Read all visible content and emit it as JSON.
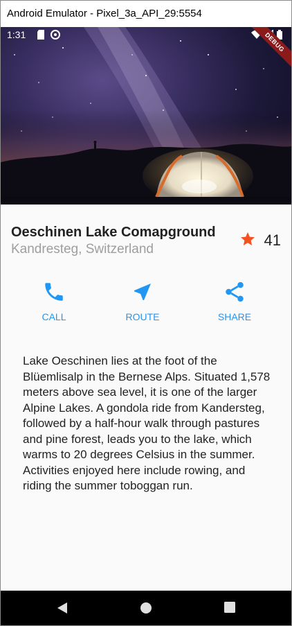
{
  "window": {
    "title": "Android Emulator - Pixel_3a_API_29:5554"
  },
  "status_bar": {
    "time": "1:31",
    "icons": [
      "sd-card-icon",
      "sync-icon",
      "wifi-icon",
      "signal-icon",
      "battery-icon"
    ]
  },
  "debug_banner": "DEBUG",
  "hero": {
    "image": "night-sky-campsite-tent"
  },
  "place": {
    "name": "Oeschinen Lake Comapground",
    "location": "Kandresteg, Switzerland"
  },
  "rating": {
    "icon": "star-icon",
    "count": "41",
    "color": "#f4511e"
  },
  "actions": [
    {
      "label": "CALL",
      "icon": "phone-icon"
    },
    {
      "label": "ROUTE",
      "icon": "navigation-icon"
    },
    {
      "label": "SHARE",
      "icon": "share-icon"
    }
  ],
  "description": "Lake Oeschinen lies at the foot of the Blüemlisalp in the Bernese Alps. Situated 1,578 meters above sea level, it is one of the larger Alpine Lakes. A gondola ride from Kandersteg, followed by a half-hour walk through pastures and pine forest, leads you to the lake, which warms to 20 degrees Celsius in the summer. Activities enjoyed here include rowing, and riding the summer toboggan run.",
  "nav_bar": {
    "buttons": [
      "back-icon",
      "home-icon",
      "recents-icon"
    ]
  },
  "colors": {
    "accent": "#2196f3",
    "star": "#f4511e",
    "subtitle": "#9e9e9e"
  }
}
